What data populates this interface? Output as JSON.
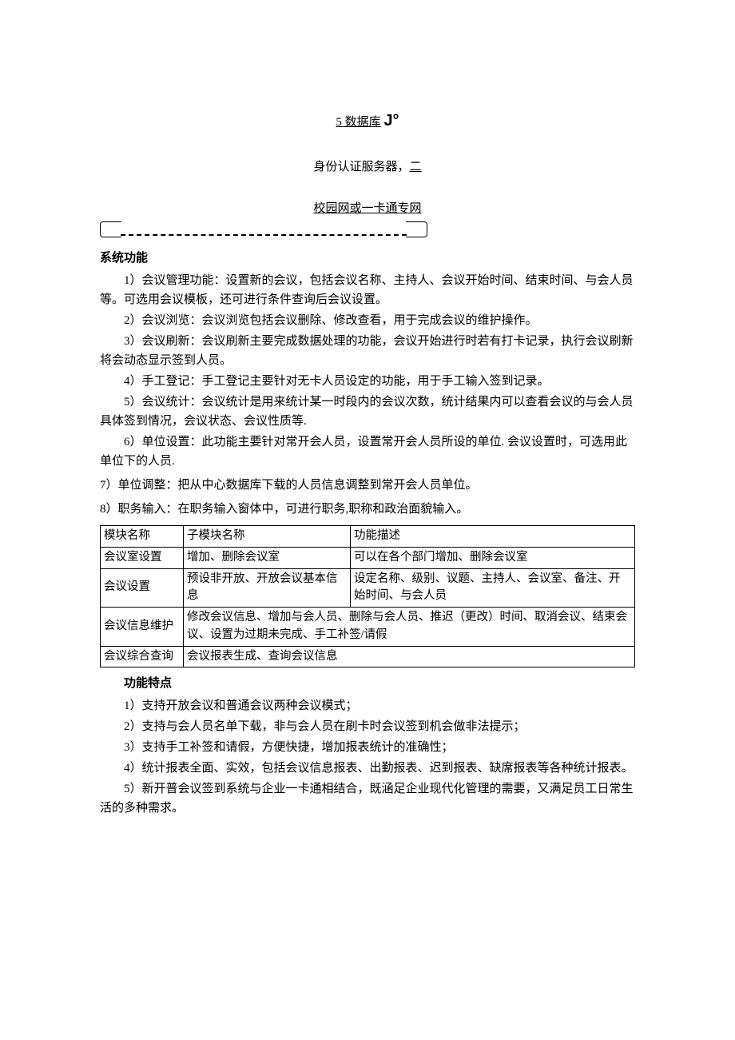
{
  "header": {
    "title_prefix": "5 数据库",
    "title_glyph": "J°",
    "auth_line_a": "身份认证服务器，",
    "auth_line_u": "二",
    "net_line": "校园网或一卡通专网"
  },
  "sections": {
    "sysfunc_title": "系统功能",
    "sysfunc_paras": [
      "1）会议管理功能：设置新的会议，包括会议名称、主持人、会议开始时间、结束时间、与会人员等。可选用会议模板，还可进行条件查询后会议设置。",
      "2）会议浏览：会议浏览包括会议删除、修改查看，用于完成会议的维护操作。",
      "3）会议刷新：会议刷新主要完成数据处理的功能，会议开始进行时若有打卡记录，执行会议刷新将会动态显示签到人员。",
      "4）手工登记：手工登记主要针对无卡人员设定的功能，用于手工输入签到记录。",
      "5）会议统计：会议统计是用来统计某一时段内的会议次数，统计结果内可以查看会议的与会人员具体签到情况，会议状态、会议性质等.",
      "6）单位设置：此功能主要针对常开会人员，设置常开会人员所设的单位. 会议设置时，可选用此单位下的人员."
    ],
    "sysfunc_noindent": [
      "7）单位调整：把从中心数据库下载的人员信息调整到常开会人员单位。",
      "8）职务输入：在职务输入窗体中，可进行职务,职称和政治面貌输入。"
    ],
    "table_headers": {
      "c1": "模块名称",
      "c2": "子模块名称",
      "c3": "功能描述"
    },
    "table_rows": [
      {
        "c1": "会议室设置",
        "c2": "增加、删除会议室",
        "c3": "可以在各个部门增加、删除会议室"
      },
      {
        "c1": "会议设置",
        "c2": "预设非开放、开放会议基本信息",
        "c3": "设定名称、级别、议题、主持人、会议室、备注、开始时间、与会人员"
      },
      {
        "c1": "会议信息维护",
        "c23": "修改会议信息、增加与会人员、删除与会人员、推迟（更改）时间、取消会议、结束会议、设置为过期未完成、手工补签/请假"
      },
      {
        "c1": "会议综合查询",
        "c23": "会议报表生成、查询会议信息"
      }
    ],
    "feat_title": "功能特点",
    "feat_paras": [
      "1）支持开放会议和普通会议两种会议模式；",
      "2）支持与会人员名单下载，非与会人员在刷卡时会议签到机会做非法提示；",
      "3）支持手工补签和请假，方便快捷，增加报表统计的准确性；",
      "4）统计报表全面、实效，包括会议信息报表、出勤报表、迟到报表、缺席报表等各种统计报表。",
      "5）新开普会议签到系统与企业一卡通相结合，既涵足企业现代化管理的需要，又满足员工日常生活的多种需求。"
    ]
  }
}
